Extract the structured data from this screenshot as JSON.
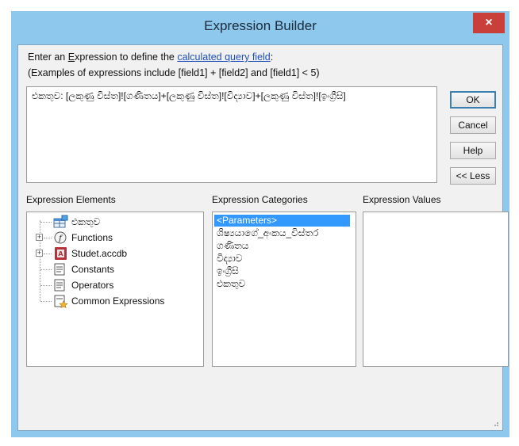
{
  "window": {
    "title": "Expression Builder",
    "close_label": "×"
  },
  "prompt": {
    "line1_pre": "Enter an ",
    "line1_accel": "E",
    "line1_mid": "xpression to define the ",
    "line1_link": "calculated query field",
    "line1_post": ":",
    "line2": "(Examples of expressions include [field1] + [field2] and [field1] < 5)"
  },
  "expression": {
    "value": "එකතුව: [ලකුණු විස්ත]![ගණිතය]+[ලකුණු විස්ත]![විද්‍යාව]+[ලකුණු විස්ත]![ඉංග්‍රීසි]"
  },
  "buttons": {
    "ok": "OK",
    "cancel": "Cancel",
    "help": "Help",
    "less": "<< Less"
  },
  "sections": {
    "elements": "Expression Elements",
    "categories": "Expression Categories",
    "values": "Expression Values"
  },
  "elements": [
    {
      "label": "එකතුව",
      "icon": "query-icon",
      "expandable": false
    },
    {
      "label": "Functions",
      "icon": "function-icon",
      "expandable": true
    },
    {
      "label": "Studet.accdb",
      "icon": "database-icon",
      "expandable": true
    },
    {
      "label": "Constants",
      "icon": "constants-icon",
      "expandable": false
    },
    {
      "label": "Operators",
      "icon": "operators-icon",
      "expandable": false
    },
    {
      "label": "Common Expressions",
      "icon": "common-expressions-icon",
      "expandable": false
    }
  ],
  "categories": [
    {
      "label": "<Parameters>",
      "selected": true
    },
    {
      "label": "ශිෂ්‍යයාගේ_අංකය_විස්තර",
      "selected": false
    },
    {
      "label": "ගණිතය",
      "selected": false
    },
    {
      "label": "විද්‍යාව",
      "selected": false
    },
    {
      "label": "ඉංග්‍රීසි",
      "selected": false
    },
    {
      "label": "එකතුව",
      "selected": false
    }
  ],
  "values": [],
  "colors": {
    "frame": "#8ec8ec",
    "close": "#c9403a",
    "selection": "#3399ff",
    "link": "#1f4fb8"
  }
}
